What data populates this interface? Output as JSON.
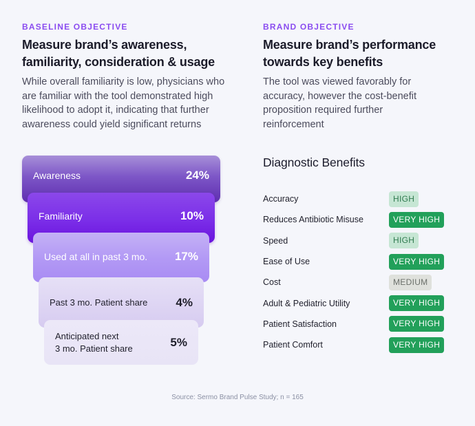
{
  "left": {
    "eyebrow": "BASELINE OBJECTIVE",
    "title": "Measure brand’s awareness, familiarity, consideration & usage",
    "description": "While overall familiarity is low, physicians who are familiar with the tool demonstrated high likelihood to adopt it, indicating that further awareness could yield significant returns",
    "funnel": [
      {
        "label": "Awareness",
        "value": "24%"
      },
      {
        "label": "Familiarity",
        "value": "10%"
      },
      {
        "label": "Used at all in past 3 mo.",
        "value": "17%"
      },
      {
        "label": "Past 3 mo. Patient share",
        "value": "4%"
      },
      {
        "label": "Anticipated next\n3 mo. Patient share",
        "value": "5%"
      }
    ]
  },
  "right": {
    "eyebrow": "BRAND OBJECTIVE",
    "title": "Measure brand’s performance towards key benefits",
    "description": "The tool was viewed favorably for accuracy, however the cost-benefit proposition required further reinforcement",
    "benefits_title": "Diagnostic Benefits",
    "benefits": [
      {
        "name": "Accuracy",
        "rating": "HIGH"
      },
      {
        "name": "Reduces Antibiotic Misuse",
        "rating": "VERY HIGH"
      },
      {
        "name": "Speed",
        "rating": "HIGH"
      },
      {
        "name": "Ease of Use",
        "rating": "VERY HIGH"
      },
      {
        "name": "Cost",
        "rating": "MEDIUM"
      },
      {
        "name": "Adult & Pediatric Utility",
        "rating": "VERY HIGH"
      },
      {
        "name": "Patient Satisfaction",
        "rating": "VERY HIGH"
      },
      {
        "name": "Patient Comfort",
        "rating": "VERY HIGH"
      }
    ]
  },
  "colors": {
    "accent": "#8a4cf0",
    "very_high": "#22a05a",
    "high": "#c6e6d4",
    "medium": "#dfe1dc"
  },
  "footer": {
    "source": "Source: Sermo Brand Pulse Study; n = 165"
  }
}
